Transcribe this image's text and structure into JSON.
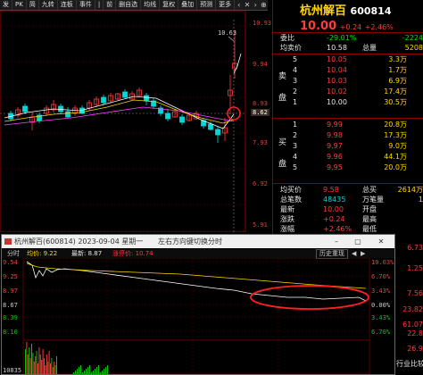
{
  "toolbar": {
    "items": [
      "发",
      "PK",
      "简",
      "九转",
      "连板",
      "事件",
      "|",
      "前",
      "删自选",
      "均线",
      "复权",
      "叠加",
      "预测",
      "更多"
    ],
    "icons": [
      "chevron-left-icon",
      "close-icon",
      "chevron-right-icon",
      "plus-icon"
    ]
  },
  "kchart": {
    "price_labels": [
      "10.93",
      "9.94",
      "8.93",
      "7.93",
      "6.92",
      "5.91"
    ],
    "current_price": "8.62",
    "high_label": "10.63",
    "ref_price": "8.62"
  },
  "quote": {
    "stock_name": "杭州解百",
    "stock_code": "600814",
    "price": "10.00",
    "change": "+0.24",
    "change_pct": "+2.46%",
    "weibi_label": "委比",
    "weibi_value": "-29.01%",
    "weicha_value": "-2224",
    "junjia_label": "均卖价",
    "junjia_value": "10.58",
    "zongliang_label": "总量",
    "zongliang_value": "5208",
    "sell": [
      {
        "label": "5",
        "price": "10.05",
        "vol": "3.3万"
      },
      {
        "label": "4",
        "price": "10.04",
        "vol": "1.7万"
      },
      {
        "label": "3",
        "price": "10.03",
        "vol": "6.9万"
      },
      {
        "label": "2",
        "price": "10.02",
        "vol": "17.4万"
      },
      {
        "label": "1",
        "price": "10.00",
        "vol": "30.5万"
      }
    ],
    "sell_side_label": [
      "卖",
      "盘"
    ],
    "buy": [
      {
        "label": "1",
        "price": "9.99",
        "vol": "20.8万"
      },
      {
        "label": "2",
        "price": "9.98",
        "vol": "17.3万"
      },
      {
        "label": "3",
        "price": "9.97",
        "vol": "9.0万"
      },
      {
        "label": "4",
        "price": "9.96",
        "vol": "44.1万"
      },
      {
        "label": "5",
        "price": "9.95",
        "vol": "20.0万"
      }
    ],
    "buy_side_label": [
      "买",
      "盘"
    ],
    "stats": [
      {
        "label": "均买价",
        "value": "9.58",
        "label2": "总买",
        "value2": "2614万"
      },
      {
        "label": "总笔数",
        "value": "48435",
        "label2": "万笔量",
        "value2": "1"
      },
      {
        "label": "最新",
        "value": "10.00",
        "label2": "开盘",
        "value2": ""
      },
      {
        "label": "涨跌",
        "value": "+0.24",
        "label2": "最高",
        "value2": ""
      },
      {
        "label": "涨幅",
        "value": "+2.46%",
        "label2": "最低",
        "value2": ""
      }
    ],
    "side_values": [
      "6.73",
      "1.25",
      "7.56",
      "23.82",
      "61.07",
      "22.8",
      "26.9",
      "行业比较"
    ]
  },
  "popup": {
    "title": "杭州解百(600814) 2023-09-04 星期一",
    "hint": "左右方向键切换分时",
    "toolbar_label": "分时",
    "avg_label": "均价: 9.22",
    "latest_label": "最新: 8.87",
    "limit_label": "涨停价: 10.74",
    "history_button": "历史重现",
    "y_left": [
      "9.54",
      "9.25",
      "8.97",
      "8.67",
      "8.39",
      "8.10"
    ],
    "y_right": [
      "10.03%",
      "6.70%",
      "3.43%",
      "0.00%",
      "3.43%",
      "6.70%"
    ],
    "volume_label": "10835"
  }
}
